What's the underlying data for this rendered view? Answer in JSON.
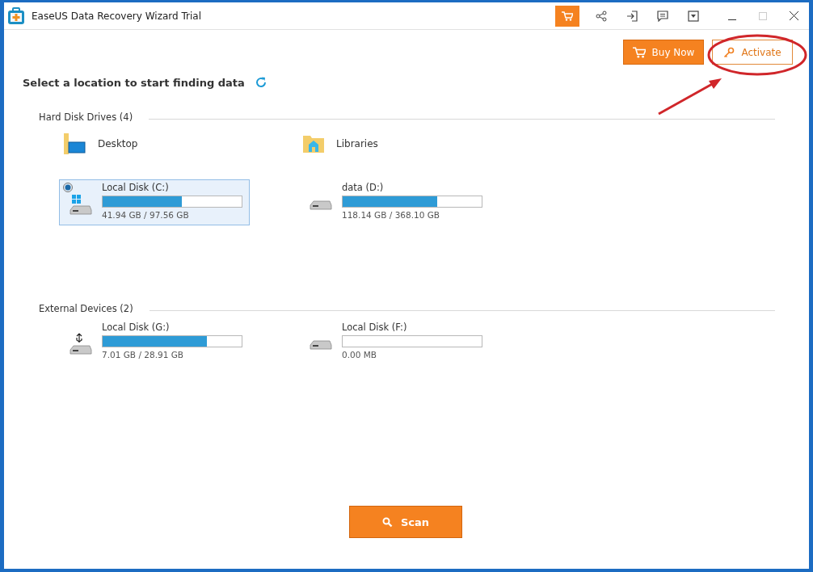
{
  "window": {
    "title": "EaseUS Data Recovery Wizard Trial"
  },
  "toolbar": [
    {
      "kind": "cart",
      "selected": true
    },
    {
      "kind": "share",
      "selected": false
    },
    {
      "kind": "signin",
      "selected": false
    },
    {
      "kind": "feedback",
      "selected": false
    },
    {
      "kind": "menu",
      "selected": false
    }
  ],
  "buttons": {
    "buy": "Buy Now",
    "activate": "Activate",
    "scan": "Scan"
  },
  "heading": "Select a location to start finding data",
  "sections": [
    {
      "title": "Hard Disk Drives (4)",
      "items": [
        {
          "kind": "desktop",
          "name": "Desktop"
        },
        {
          "kind": "library",
          "name": "Libraries"
        },
        {
          "kind": "system",
          "name": "Local Disk (C:)",
          "level": 0.57,
          "size": "41.94 GB / 97.56 GB",
          "selected": true
        },
        {
          "kind": "drive",
          "name": "data (D:)",
          "level": 0.68,
          "size": "118.14 GB / 368.10 GB",
          "selected": false
        }
      ]
    },
    {
      "title": "External Devices (2)",
      "items": [
        {
          "kind": "usb",
          "name": "Local Disk (G:)",
          "level": 0.75,
          "size": "7.01 GB / 28.91 GB",
          "selected": false
        },
        {
          "kind": "drive",
          "name": "Local Disk (F:)",
          "size": "0.00 MB",
          "selected": false
        }
      ]
    }
  ]
}
